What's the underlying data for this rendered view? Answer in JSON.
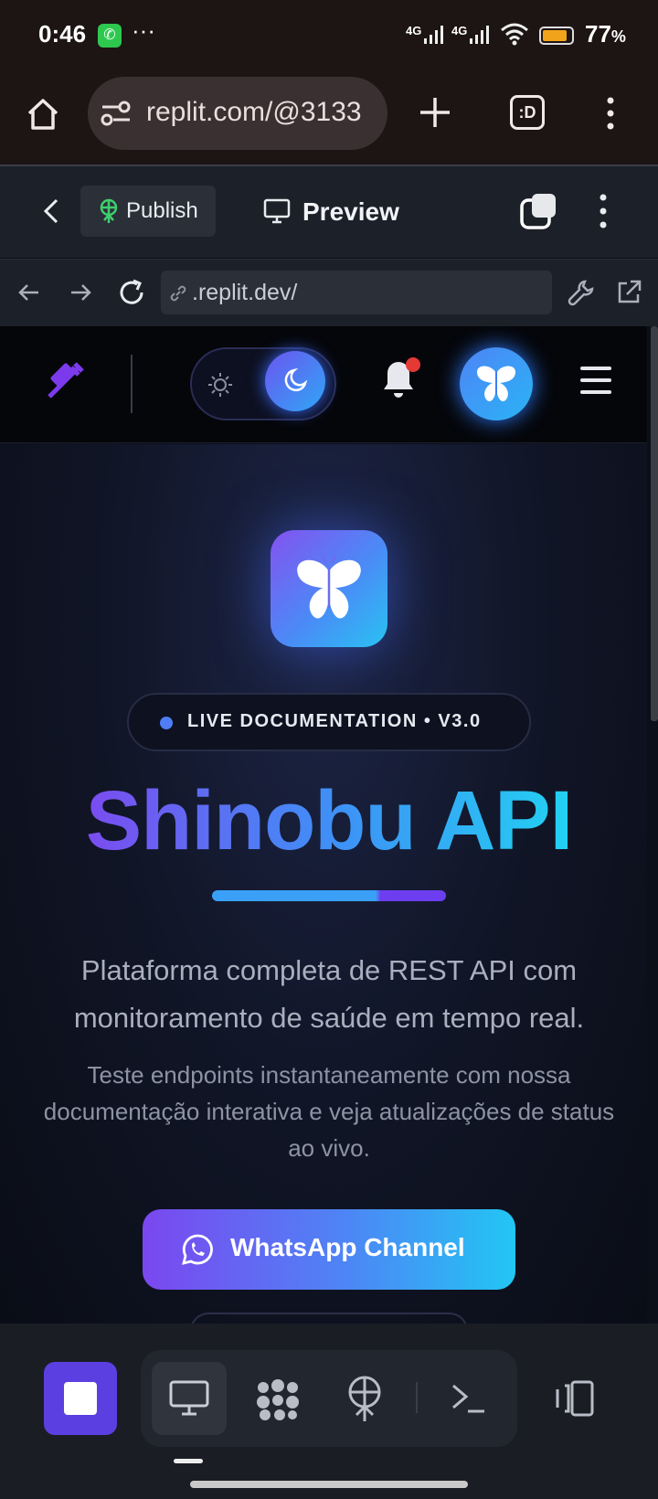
{
  "status_bar": {
    "time": "0:46",
    "more": "···",
    "network_1": "4G",
    "network_2": "4G",
    "battery": "77",
    "battery_unit": "%"
  },
  "browser": {
    "url": "replit.com/@3133",
    "tab_icon": ":D"
  },
  "replit": {
    "publish_label": "Publish",
    "preview_label": "Preview",
    "inner_url": ".replit.dev/"
  },
  "hero": {
    "badge": "LIVE DOCUMENTATION • V3.0",
    "title": "Shinobu API",
    "lead": "Plataforma completa de REST API com monitoramento de saúde em tempo real.",
    "sub": "Teste endpoints instantaneamente com nossa documentação interativa e veja atualizações de status ao vivo.",
    "cta": "WhatsApp Channel"
  },
  "colors": {
    "accent_purple": "#7b47f0",
    "accent_cyan": "#22c6f4",
    "notification_dot": "#e53935"
  }
}
